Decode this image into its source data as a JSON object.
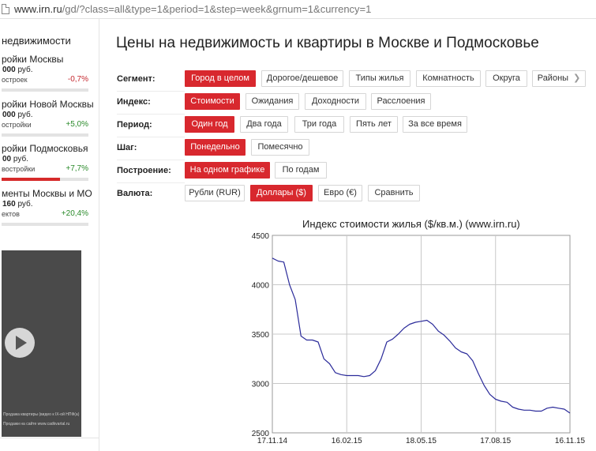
{
  "address_bar": {
    "host": "www.irn.ru",
    "path": "/gd/?class=all&type=1&period=1&step=week&grnum=1&currency=1"
  },
  "sidebar": {
    "title": "недвижимости",
    "items": [
      {
        "name": "ройки Москвы",
        "price": "000",
        "price_unit": "руб.",
        "sub": "остроек",
        "change": "-0,7%",
        "trend": "neg",
        "bar_fill": 0.0
      },
      {
        "name": "ройки Новой Москвы",
        "price": "000",
        "price_unit": "руб.",
        "sub": "остройки",
        "change": "+5,0%",
        "trend": "pos",
        "bar_fill": 0.0
      },
      {
        "name": "ройки Подмосковья",
        "price": "00",
        "price_unit": "руб.",
        "sub": "востройки",
        "change": "+7,7%",
        "trend": "pos",
        "bar_fill": 0.67
      },
      {
        "name": "менты Москвы и МО",
        "price": "160",
        "price_unit": "руб.",
        "sub": "ектов",
        "change": "+20,4%",
        "trend": "pos",
        "bar_fill": 0.0
      }
    ],
    "video_caption_1": "Продажа квартиры (видео к IX-ой НПФ(а)",
    "video_caption_2": "Продажи на сайте www.cadkvartal.ru"
  },
  "page_title": "Цены на недвижимость и квартиры в Москве и Подмосковье",
  "filters": [
    {
      "label": "Сегмент:",
      "options": [
        {
          "text": "Город в целом",
          "active": true
        },
        {
          "text": "Дорогое/дешевое",
          "active": false
        },
        {
          "text": "Типы жилья",
          "active": false
        },
        {
          "text": "Комнатность",
          "active": false
        },
        {
          "text": "Округа",
          "active": false
        },
        {
          "text": "Районы",
          "active": false
        }
      ]
    },
    {
      "label": "Индекс:",
      "options": [
        {
          "text": "Стоимости",
          "active": true
        },
        {
          "text": "Ожидания",
          "active": false
        },
        {
          "text": "Доходности",
          "active": false
        },
        {
          "text": "Расслоения",
          "active": false
        }
      ]
    },
    {
      "label": "Период:",
      "options": [
        {
          "text": "Один год",
          "active": true
        },
        {
          "text": "Два года",
          "active": false
        },
        {
          "text": "Три года",
          "active": false
        },
        {
          "text": "Пять лет",
          "active": false
        },
        {
          "text": "За все время",
          "active": false
        }
      ]
    },
    {
      "label": "Шаг:",
      "options": [
        {
          "text": "Понедельно",
          "active": true
        },
        {
          "text": "Помесячно",
          "active": false
        }
      ]
    },
    {
      "label": "Построение:",
      "options": [
        {
          "text": "На одном графике",
          "active": true
        },
        {
          "text": "По годам",
          "active": false
        }
      ]
    },
    {
      "label": "Валюта:",
      "options": [
        {
          "text": "Рубли (RUR)",
          "active": false
        },
        {
          "text": "Доллары ($)",
          "active": true
        },
        {
          "text": "Евро (€)",
          "active": false
        },
        {
          "text": "Сравнить",
          "active": false
        }
      ]
    }
  ],
  "colors": {
    "accent": "#d8282e",
    "line": "#2b2b9a",
    "grid": "#c8c8c8"
  },
  "chart_data": {
    "type": "line",
    "title": "Индекс стоимости жилья ($/кв.м.) (www.irn.ru)",
    "x_tick_labels": [
      "17.11.14",
      "16.02.15",
      "18.05.15",
      "17.08.15",
      "16.11.15"
    ],
    "y_tick_labels": [
      "2500",
      "3000",
      "3500",
      "4000",
      "4500"
    ],
    "ylim": [
      2500,
      4500
    ],
    "grid": true,
    "series": [
      {
        "x": [
          "17.11.14",
          "24.11.14",
          "01.12.14",
          "08.12.14",
          "15.12.14",
          "22.12.14",
          "29.12.14",
          "05.01.15",
          "12.01.15",
          "19.01.15",
          "26.01.15",
          "02.02.15",
          "09.02.15",
          "16.02.15",
          "23.02.15",
          "02.03.15",
          "09.03.15",
          "16.03.15",
          "23.03.15",
          "30.03.15",
          "06.04.15",
          "13.04.15",
          "20.04.15",
          "27.04.15",
          "04.05.15",
          "11.05.15",
          "18.05.15",
          "25.05.15",
          "01.06.15",
          "08.06.15",
          "15.06.15",
          "22.06.15",
          "29.06.15",
          "06.07.15",
          "13.07.15",
          "20.07.15",
          "27.07.15",
          "03.08.15",
          "10.08.15",
          "17.08.15",
          "24.08.15",
          "31.08.15",
          "07.09.15",
          "14.09.15",
          "21.09.15",
          "28.09.15",
          "05.10.15",
          "12.10.15",
          "19.10.15",
          "26.10.15",
          "02.11.15",
          "09.11.15",
          "16.11.15"
        ],
        "values": [
          4270,
          4240,
          4230,
          4000,
          3850,
          3480,
          3440,
          3440,
          3420,
          3250,
          3200,
          3110,
          3090,
          3080,
          3080,
          3080,
          3070,
          3080,
          3130,
          3250,
          3420,
          3450,
          3500,
          3560,
          3600,
          3620,
          3630,
          3640,
          3600,
          3530,
          3490,
          3430,
          3360,
          3320,
          3300,
          3230,
          3100,
          2980,
          2890,
          2840,
          2820,
          2810,
          2760,
          2740,
          2730,
          2730,
          2720,
          2720,
          2750,
          2760,
          2750,
          2740,
          2700
        ]
      }
    ]
  }
}
